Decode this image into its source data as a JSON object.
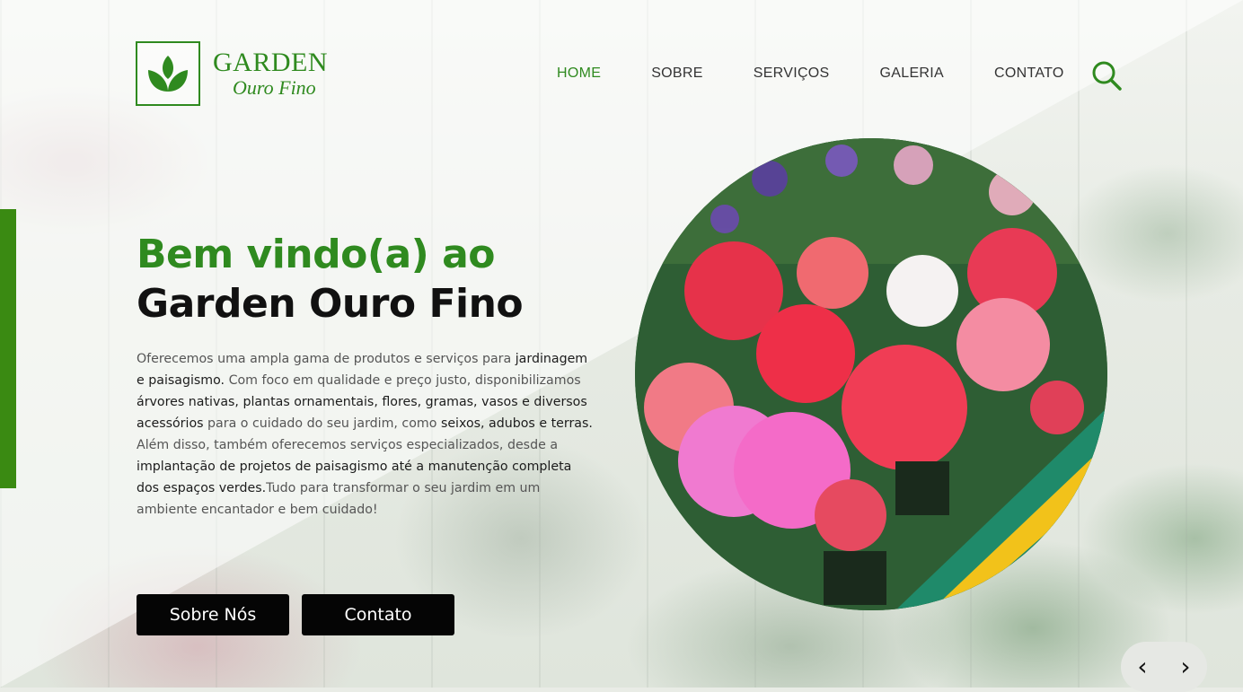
{
  "logo": {
    "line1": "GARDEN",
    "line2": "Ouro Fino",
    "icon": "leaf-icon"
  },
  "nav": {
    "items": [
      {
        "label": "HOME",
        "active": true
      },
      {
        "label": "SOBRE",
        "active": false
      },
      {
        "label": "SERVIÇOS",
        "active": false
      },
      {
        "label": "GALERIA",
        "active": false
      },
      {
        "label": "CONTATO",
        "active": false
      }
    ],
    "search_icon": "search-icon"
  },
  "hero": {
    "title_line1": "Bem vindo(a) ao",
    "title_line2": "Garden Ouro Fino",
    "description": [
      {
        "t": "Oferecemos uma ampla gama de produtos e serviços para ",
        "b": false
      },
      {
        "t": "jardinagem e paisagismo.",
        "b": true
      },
      {
        "t": " Com foco em qualidade e preço justo, disponibilizamos ",
        "b": false
      },
      {
        "t": "árvores nativas, plantas ornamentais, flores, gramas, vasos e diversos acessórios",
        "b": true
      },
      {
        "t": " para o cuidado do seu jardim, como ",
        "b": false
      },
      {
        "t": "seixos, adubos e terras.",
        "b": true
      },
      {
        "t": " Além disso, também oferecemos serviços especializados, desde a ",
        "b": false
      },
      {
        "t": "implantação de projetos de paisagismo até a manutenção completa dos espaços verdes.",
        "b": true
      },
      {
        "t": "Tudo para transformar o seu jardim em um ambiente encantador e bem cuidado!",
        "b": false
      }
    ],
    "buttons": {
      "about": "Sobre Nós",
      "contact": "Contato"
    }
  },
  "carousel": {
    "prev": "‹",
    "next": "›"
  },
  "colors": {
    "brand_green": "#2f8a1f",
    "side_bar": "#3a8a12",
    "button_bg": "#050505"
  }
}
